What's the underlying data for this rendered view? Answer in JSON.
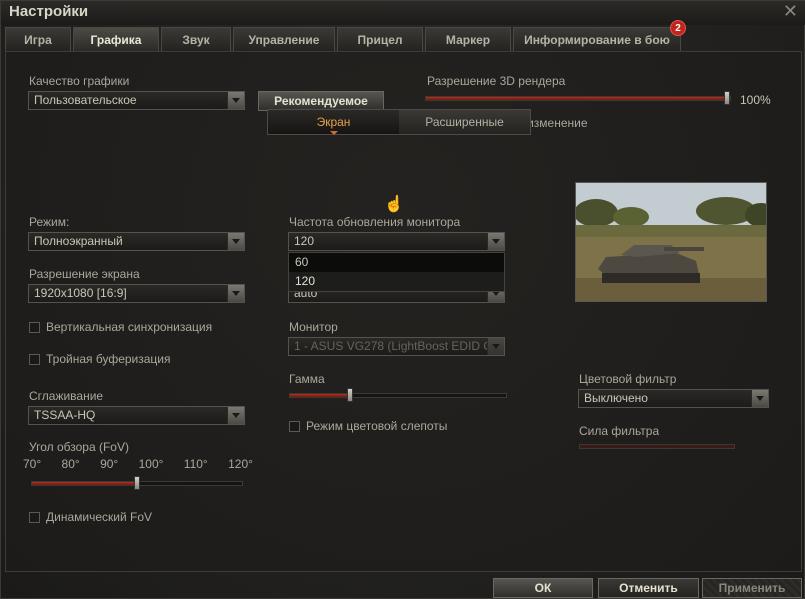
{
  "window": {
    "title": "Настройки"
  },
  "tabs": [
    {
      "label": "Игра",
      "active": false
    },
    {
      "label": "Графика",
      "active": true
    },
    {
      "label": "Звук",
      "active": false
    },
    {
      "label": "Управление",
      "active": false
    },
    {
      "label": "Прицел",
      "active": false
    },
    {
      "label": "Маркер",
      "active": false
    },
    {
      "label": "Информирование в бою",
      "active": false,
      "badge": "2"
    }
  ],
  "graphics": {
    "quality_label": "Качество графики",
    "quality_value": "Пользовательское",
    "recommended_button": "Рекомендуемое",
    "render_label": "Разрешение 3D рендера",
    "render_value": "100%",
    "render_fraction": 1.0,
    "dynamic_change_label": "Динамическое изменение",
    "dynamic_change_checked": false
  },
  "subtabs": [
    {
      "label": "Экран",
      "active": true
    },
    {
      "label": "Расширенные",
      "active": false
    }
  ],
  "screen": {
    "mode_label": "Режим:",
    "mode_value": "Полноэкранный",
    "resolution_label": "Разрешение экрана",
    "resolution_value": "1920x1080 [16:9]",
    "vsync_label": "Вертикальная синхронизация",
    "triple_buffer_label": "Тройная буферизация",
    "aa_label": "Сглаживание",
    "aa_value": "TSSAA-HQ",
    "fov_label": "Угол обзора (FoV)",
    "fov_ticks": [
      "70°",
      "80°",
      "90°",
      "100°",
      "110°",
      "120°"
    ],
    "fov_fraction": 0.5,
    "dynamic_fov_label": "Динамический FoV",
    "refresh_label": "Частота обновления монитора",
    "refresh_value": "120",
    "refresh_options": [
      "60",
      "120"
    ],
    "hidden_select_value": "auto",
    "monitor_label": "Монитор",
    "monitor_value": "1 - ASUS VG278 (LightBoost EDID O",
    "gamma_label": "Гамма",
    "gamma_fraction": 0.28,
    "colorblind_label": "Режим цветовой слепоты",
    "color_filter_label": "Цветовой фильтр",
    "color_filter_value": "Выключено",
    "filter_strength_label": "Сила фильтра"
  },
  "buttons": {
    "ok": "ОК",
    "cancel": "Отменить",
    "apply": "Применить"
  },
  "colors": {
    "accent": "#e8a04a",
    "slider_fill": "#b3301f",
    "badge": "#c0261b"
  }
}
